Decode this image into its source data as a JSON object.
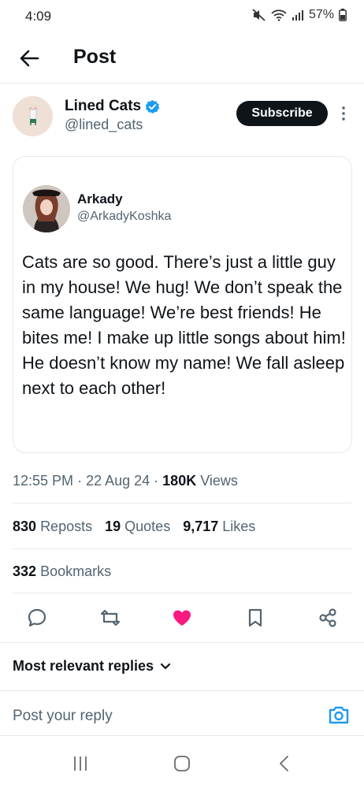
{
  "status": {
    "time": "4:09",
    "battery": "57%"
  },
  "header": {
    "title": "Post"
  },
  "author": {
    "name": "Lined Cats",
    "handle": "@lined_cats",
    "subscribe_label": "Subscribe"
  },
  "quote": {
    "name": "Arkady",
    "handle": "@ArkadyKoshka",
    "text": "Cats are so good. There’s just a little guy in my house! We hug! We don’t speak the same language! We’re best friends! He bites me! I make up little songs about him! He doesn’t know my name! We fall asleep next to each other!"
  },
  "meta": {
    "time": "12:55 PM",
    "date": "22 Aug 24",
    "views_count": "180K",
    "views_label": "Views"
  },
  "stats": {
    "reposts_count": "830",
    "reposts_label": "Reposts",
    "quotes_count": "19",
    "quotes_label": "Quotes",
    "likes_count": "9,717",
    "likes_label": "Likes",
    "bookmarks_count": "332",
    "bookmarks_label": "Bookmarks"
  },
  "actions": {
    "icons": [
      "reply-icon",
      "repost-icon",
      "like-icon",
      "bookmark-icon",
      "share-icon"
    ],
    "like_color": "#f91880"
  },
  "replies": {
    "sort_label": "Most relevant replies",
    "placeholder": "Post your reply"
  },
  "colors": {
    "accent": "#1d9bf0",
    "text_primary": "#0f1419",
    "text_secondary": "#536471"
  }
}
